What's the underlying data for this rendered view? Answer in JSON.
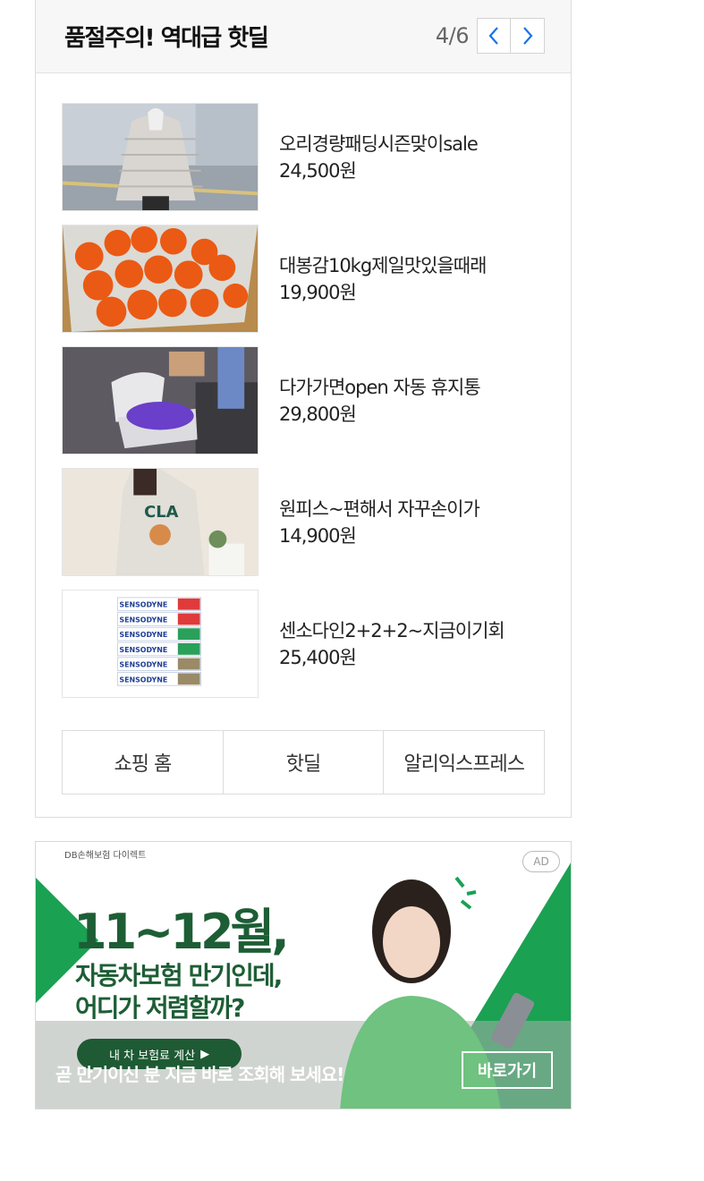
{
  "hotdeal": {
    "title": "품절주의! 역대급 핫딜",
    "pager": {
      "text": "4/6",
      "prev_icon": "chevron-left-icon",
      "next_icon": "chevron-right-icon"
    },
    "items": [
      {
        "name": "오리경량패딩시즌맞이sale",
        "price": "24,500원",
        "image": "padded-jacket-photo"
      },
      {
        "name": "대봉감10kg제일맛있을때래",
        "price": "19,900원",
        "image": "persimmon-box-photo"
      },
      {
        "name": "다가가면open 자동 휴지통",
        "price": "29,800원",
        "image": "auto-trash-can-photo"
      },
      {
        "name": "원피스~편해서 자꾸손이가",
        "price": "14,900원",
        "image": "sweatshirt-dress-photo"
      },
      {
        "name": "센소다인2+2+2~지금이기회",
        "price": "25,400원",
        "image": "toothpaste-photo"
      }
    ],
    "tabs": [
      "쇼핑 홈",
      "핫딜",
      "알리익스프레스"
    ]
  },
  "ad": {
    "headline": "11~12월,",
    "line2": "자동차보험 만기인데,",
    "line3": "어디가 저렴할까?",
    "cta": "내 차 보험료 계산",
    "banner": "곧 만기이신 분 지금 바로 조회해 보세요!",
    "go_button": "바로가기",
    "badge": "AD",
    "brand": "DB손해보험 다이렉트",
    "colors": {
      "green": "#1aa152",
      "dark_green": "#1d5e35"
    }
  }
}
